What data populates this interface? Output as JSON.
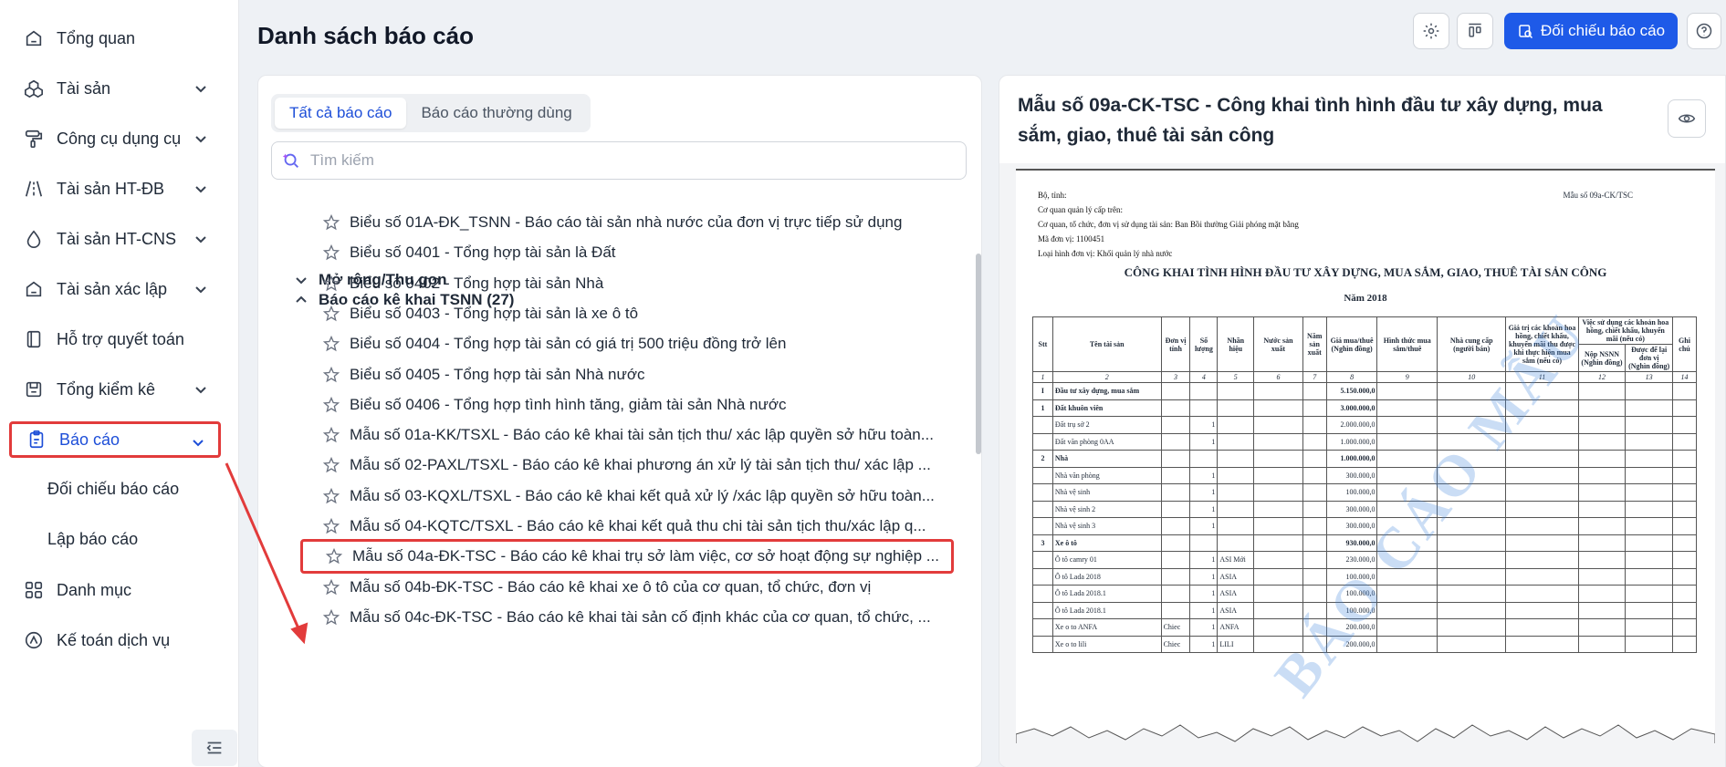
{
  "sidebar": {
    "items": [
      {
        "label": "Tổng quan",
        "icon": "home-icon",
        "chevron": false
      },
      {
        "label": "Tài sản",
        "icon": "boxes-icon",
        "chevron": true
      },
      {
        "label": "Công cụ dụng cụ",
        "icon": "paint-roller-icon",
        "chevron": true
      },
      {
        "label": "Tài sản HT-ĐB",
        "icon": "road-icon",
        "chevron": true
      },
      {
        "label": "Tài sản HT-CNS",
        "icon": "droplet-icon",
        "chevron": true
      },
      {
        "label": "Tài sản xác lập",
        "icon": "house-icon",
        "chevron": true
      },
      {
        "label": "Hỗ trợ quyết toán",
        "icon": "notebook-icon",
        "chevron": false
      },
      {
        "label": "Tổng kiểm kê",
        "icon": "box-check-icon",
        "chevron": true
      },
      {
        "label": "Báo cáo",
        "icon": "report-icon",
        "chevron": true,
        "active": true
      },
      {
        "label": "Danh mục",
        "icon": "grid-icon",
        "chevron": false
      },
      {
        "label": "Kế toán dịch vụ",
        "icon": "accounting-icon",
        "chevron": false
      }
    ],
    "subitems": [
      "Đối chiếu báo cáo",
      "Lập báo cáo"
    ]
  },
  "header": {
    "title": "Danh sách báo cáo",
    "compare_button": "Đối chiếu báo cáo"
  },
  "left": {
    "tabs": [
      "Tất cả báo cáo",
      "Báo cáo thường dùng"
    ],
    "search_placeholder": "Tìm kiếm",
    "expand_label": "Mở rộng/Thu gọn",
    "group_label": "Báo cáo kê khai TSNN (27)",
    "reports": [
      "Biểu số 01A-ĐK_TSNN - Báo cáo tài sản nhà nước của đơn vị trực tiếp sử dụng",
      "Biểu số 0401 - Tổng hợp tài sản là Đất",
      "Biểu số 0402 - Tổng hợp tài sản Nhà",
      "Biểu số 0403 - Tổng hợp tài sản là xe ô tô",
      "Biểu số 0404 - Tổng hợp tài sản có giá trị 500 triệu đồng trở lên",
      "Biểu số 0405 - Tổng hợp tài sản Nhà nước",
      "Biểu số 0406 - Tổng hợp tình hình tăng, giảm tài sản Nhà nước",
      "Mẫu số 01a-KK/TSXL - Báo cáo kê khai tài sản tịch thu/ xác lập quyền sở hữu toàn...",
      "Mẫu số 02-PAXL/TSXL - Báo cáo kê khai phương án xử lý tài sản tịch thu/ xác lập ...",
      "Mẫu số 03-KQXL/TSXL - Báo cáo kê khai kết quả xử lý /xác lập quyền sở hữu toàn...",
      "Mẫu số 04-KQTC/TSXL - Báo cáo kê khai kết quả thu chi tài sản tịch thu/xác lập q...",
      "Mẫu số 04a-ĐK-TSC - Báo cáo kê khai trụ sở làm việc, cơ sở hoạt động sự nghiệp ...",
      "Mẫu số 04b-ĐK-TSC - Báo cáo kê khai xe ô tô của cơ quan, tổ chức, đơn vị",
      "Mẫu số 04c-ĐK-TSC - Báo cáo kê khai tài sản cố định khác của cơ quan, tổ chức, ..."
    ]
  },
  "preview": {
    "title": "Mẫu số 09a-CK-TSC - Công khai tình hình đầu tư xây dựng, mua sắm, giao, thuê tài sản công",
    "doc": {
      "meta": [
        "Bộ, tỉnh:",
        "Cơ quan quản lý cấp trên:",
        "Cơ quan, tổ chức, đơn vị sử dụng tài sản: Ban Bồi thường Giải phóng mặt bằng",
        "Mã đơn vị: 1100451",
        "Loại hình đơn vị: Khối quản lý nhà nước"
      ],
      "form_code": "Mẫu số 09a-CK/TSC",
      "title": "CÔNG KHAI TÌNH HÌNH ĐẦU TƯ XÂY DỰNG, MUA SẮM, GIAO, THUÊ TÀI SẢN CÔNG",
      "year": "Năm 2018",
      "watermark": "BÁO CÁO MẪU",
      "headers": [
        "Stt",
        "Tên tài sản",
        "Đơn vị tính",
        "Số lượng",
        "Nhãn hiệu",
        "Nước sản xuất",
        "Năm sản xuất",
        "Giá mua/thuê (Nghìn đồng)",
        "Hình thức mua sắm/thuê",
        "Nhà cung cấp (người bán)",
        "Giá trị các khoản hoa hồng, chiết khấu, khuyến mãi thu được khi thực hiện mua sắm (nếu có)",
        "Nộp NSNN (Nghìn đồng)",
        "Được để lại đơn vị (Nghìn đồng)",
        "Ghi chú"
      ],
      "group_header": "Việc sử dụng các khoản hoa hồng, chiết khấu, khuyến mãi (nếu có)",
      "col_numbers": [
        "1",
        "2",
        "3",
        "4",
        "5",
        "6",
        "7",
        "8",
        "9",
        "10",
        "11",
        "12",
        "13",
        "14"
      ],
      "rows": [
        {
          "stt": "I",
          "name": "Đầu tư xây dựng, mua sắm",
          "unit": "",
          "qty": "",
          "brand": "",
          "price": "5.150.000,0",
          "bold": true
        },
        {
          "stt": "1",
          "name": "Đất khuôn viên",
          "unit": "",
          "qty": "",
          "brand": "",
          "price": "3.000.000,0",
          "bold": true
        },
        {
          "stt": "",
          "name": "Đất trụ sở 2",
          "unit": "",
          "qty": "1",
          "brand": "",
          "price": "2.000.000,0",
          "bold": false
        },
        {
          "stt": "",
          "name": "Đất văn phòng 0AA",
          "unit": "",
          "qty": "1",
          "brand": "",
          "price": "1.000.000,0",
          "bold": false
        },
        {
          "stt": "2",
          "name": "Nhà",
          "unit": "",
          "qty": "",
          "brand": "",
          "price": "1.000.000,0",
          "bold": true
        },
        {
          "stt": "",
          "name": "Nhà văn phòng",
          "unit": "",
          "qty": "1",
          "brand": "",
          "price": "300.000,0",
          "bold": false
        },
        {
          "stt": "",
          "name": "Nhà vệ sinh",
          "unit": "",
          "qty": "1",
          "brand": "",
          "price": "100.000,0",
          "bold": false
        },
        {
          "stt": "",
          "name": "Nhà vệ sinh 2",
          "unit": "",
          "qty": "1",
          "brand": "",
          "price": "300.000,0",
          "bold": false
        },
        {
          "stt": "",
          "name": "Nhà vệ sinh 3",
          "unit": "",
          "qty": "1",
          "brand": "",
          "price": "300.000,0",
          "bold": false
        },
        {
          "stt": "3",
          "name": "Xe ô tô",
          "unit": "",
          "qty": "",
          "brand": "",
          "price": "930.000,0",
          "bold": true
        },
        {
          "stt": "",
          "name": "Ô tô camry 01",
          "unit": "",
          "qty": "1",
          "brand": "ASI Mới",
          "price": "230.000,0",
          "bold": false
        },
        {
          "stt": "",
          "name": "Ô tô Lada 2018",
          "unit": "",
          "qty": "1",
          "brand": "ASIA",
          "price": "100.000,0",
          "bold": false
        },
        {
          "stt": "",
          "name": "Ô tô Lada 2018.1",
          "unit": "",
          "qty": "1",
          "brand": "ASIA",
          "price": "100.000,0",
          "bold": false
        },
        {
          "stt": "",
          "name": "Ô tô Lada 2018.1",
          "unit": "",
          "qty": "1",
          "brand": "ASIA",
          "price": "100.000,0",
          "bold": false
        },
        {
          "stt": "",
          "name": "Xe o to ANFA",
          "unit": "Chiec",
          "qty": "1",
          "brand": "ANFA",
          "price": "200.000,0",
          "bold": false
        },
        {
          "stt": "",
          "name": "Xe o to lili",
          "unit": "Chiec",
          "qty": "1",
          "brand": "LILI",
          "price": "200.000,0",
          "bold": false
        }
      ]
    }
  },
  "colors": {
    "accent": "#1e5ae8",
    "highlight": "#e23b3b"
  }
}
